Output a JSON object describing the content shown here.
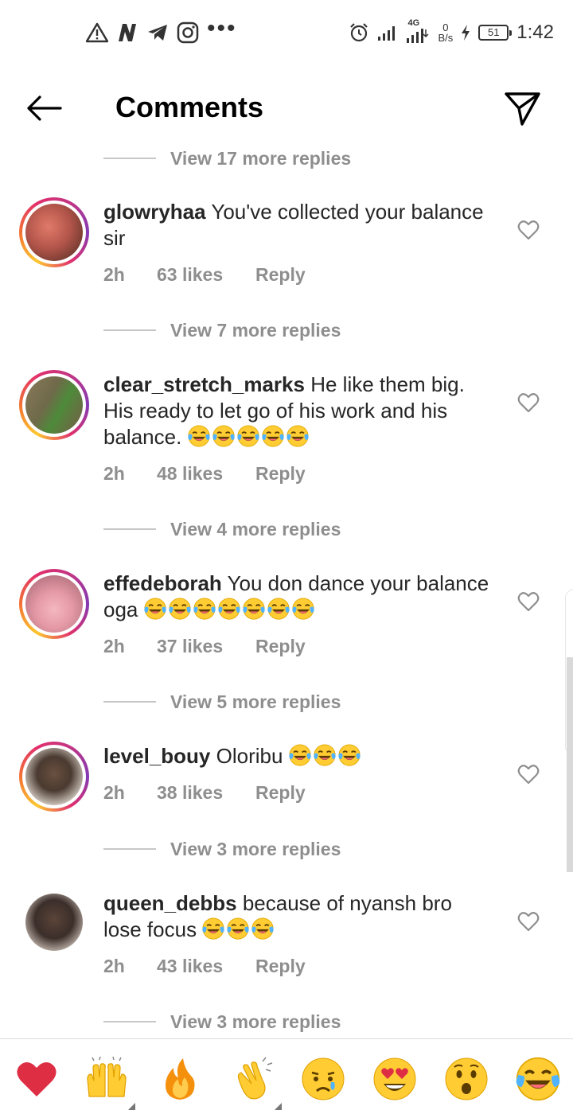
{
  "status_bar": {
    "time": "1:42",
    "network": "4G",
    "speed_value": "0",
    "speed_unit": "B/s",
    "battery": "51",
    "left_icons": [
      "warning-icon",
      "n-app-icon",
      "telegram-icon",
      "instagram-icon",
      "more-dots-icon"
    ],
    "right_icons": [
      "alarm-icon",
      "signal-icon",
      "signal-4g-icon",
      "charging-icon",
      "battery-icon"
    ]
  },
  "header": {
    "title": "Comments",
    "back_icon": "arrow-left-icon",
    "send_icon": "send-icon"
  },
  "top_view_more": "View 17 more replies",
  "comments": [
    {
      "username": "glowryhaa",
      "text": "You've collected your balance sir",
      "emoji_count": 0,
      "time": "2h",
      "likes": "63 likes",
      "reply": "Reply",
      "story_ring": true,
      "view_more": "View 7 more replies",
      "avatar_color": "#b3554a"
    },
    {
      "username": "clear_stretch_marks",
      "text": "He like them big. His ready to let go of his work and his balance.",
      "emoji_count": 5,
      "time": "2h",
      "likes": "48 likes",
      "reply": "Reply",
      "story_ring": true,
      "view_more": "View 4 more replies",
      "avatar_color": "#6f6a4a"
    },
    {
      "username": "effedeborah",
      "text": "You don dance your balance oga",
      "emoji_count": 7,
      "time": "2h",
      "likes": "37 likes",
      "reply": "Reply",
      "story_ring": true,
      "view_more": "View 5 more replies",
      "avatar_color": "#e59aa6"
    },
    {
      "username": "level_bouy",
      "text": "Oloribu",
      "emoji_count": 3,
      "time": "2h",
      "likes": "38 likes",
      "reply": "Reply",
      "story_ring": true,
      "view_more": "View 3 more replies",
      "avatar_color": "#4a3a30"
    },
    {
      "username": "queen_debbs",
      "text": "because of nyansh bro lose focus",
      "emoji_count": 3,
      "time": "2h",
      "likes": "43 likes",
      "reply": "Reply",
      "story_ring": false,
      "view_more": "View 3 more replies",
      "avatar_color": "#3b2e2a"
    }
  ],
  "emoji_name": "face-with-tears-of-joy",
  "reactions": [
    {
      "name": "red-heart",
      "variants": false
    },
    {
      "name": "raising-hands",
      "variants": true
    },
    {
      "name": "fire",
      "variants": false
    },
    {
      "name": "clapping-hands",
      "variants": true
    },
    {
      "name": "crying-face",
      "variants": false
    },
    {
      "name": "heart-eyes",
      "variants": false
    },
    {
      "name": "astonished-face",
      "variants": false
    },
    {
      "name": "tears-of-joy",
      "variants": false
    }
  ]
}
